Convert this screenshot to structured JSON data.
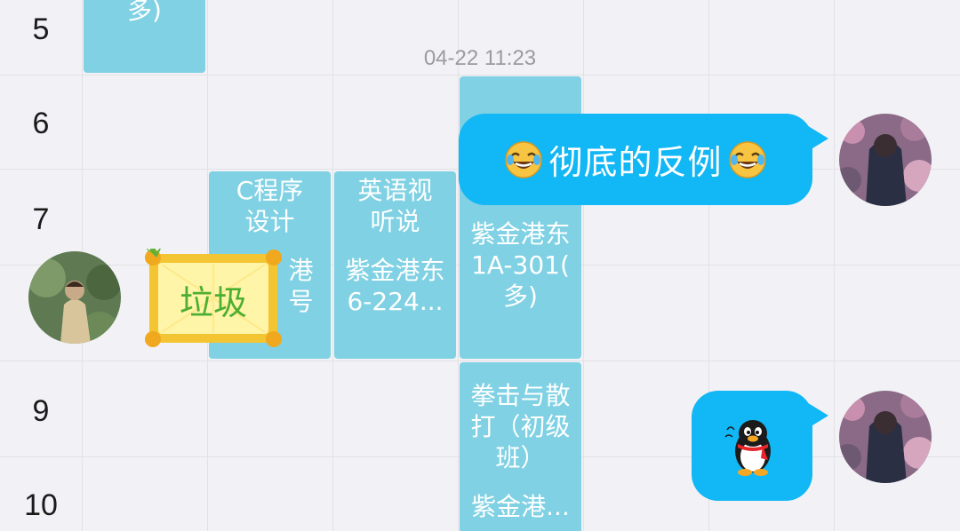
{
  "timetable": {
    "row_numbers": [
      "5",
      "6",
      "7",
      "9",
      "10"
    ],
    "courses": [
      {
        "id": "top-left",
        "lines": [
          "多)"
        ]
      },
      {
        "id": "c-programming",
        "lines": [
          "C程序",
          "设计",
          "",
          "港",
          "号"
        ]
      },
      {
        "id": "english",
        "lines": [
          "英语视",
          "听说",
          "",
          "紫金港东",
          "6-224..."
        ]
      },
      {
        "id": "big-block",
        "lines": [
          "",
          "",
          "",
          "紫金港东",
          "1A-301(",
          "多)"
        ]
      },
      {
        "id": "boxing",
        "lines": [
          "拳击与散",
          "打（初级",
          "班）",
          "",
          "紫金港..."
        ]
      }
    ]
  },
  "chat": {
    "timestamp": "04-22 11:23",
    "messages": [
      {
        "side": "right",
        "text": "彻底的反例",
        "emoji_before": "joy-emoji",
        "emoji_after": "joy-emoji"
      },
      {
        "side": "left",
        "text": "垃圾",
        "style": "gold-frame-sticker"
      },
      {
        "side": "right",
        "text": "",
        "sticker": "qq-penguin-icon"
      }
    ]
  },
  "colors": {
    "bubble_blue": "#12b7f5",
    "course_blue": "#7fd1e3",
    "background": "#f2f2f6",
    "trash_text_green": "#4caf32"
  }
}
